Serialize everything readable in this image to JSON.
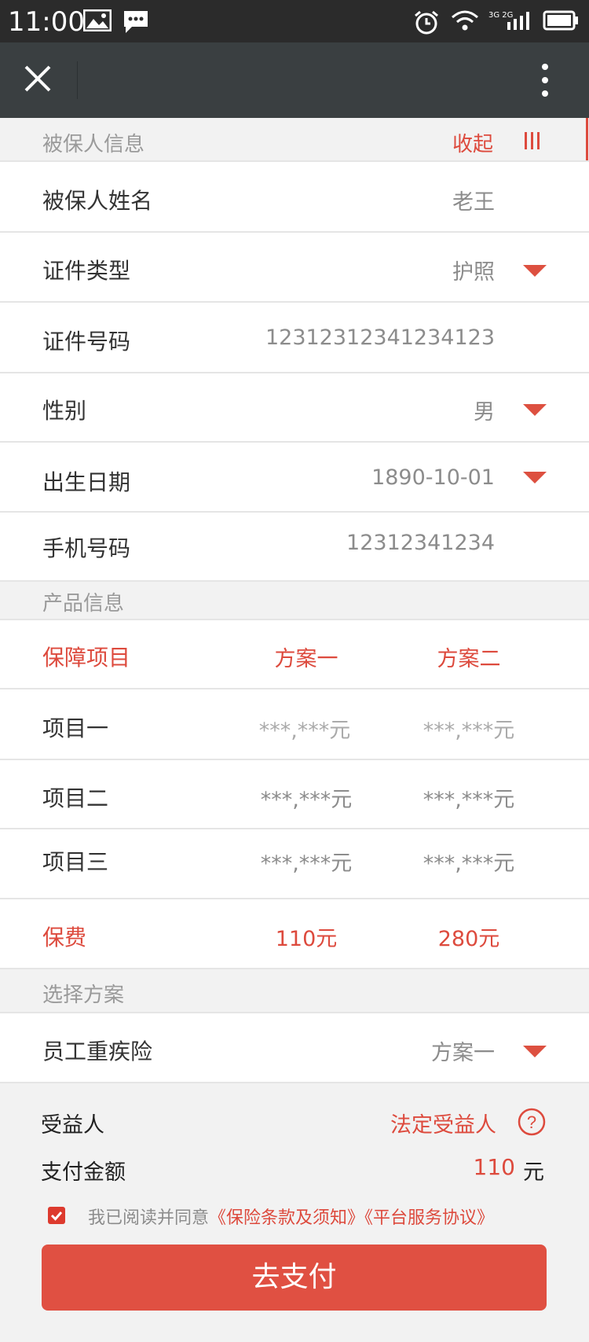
{
  "statusbar": {
    "time": "11:00",
    "network": "3G 2G"
  },
  "insured": {
    "section_title": "被保人信息",
    "collapse_label": "收起",
    "rows": [
      {
        "label": "被保人姓名",
        "value": "老王"
      },
      {
        "label": "证件类型",
        "value": "护照"
      },
      {
        "label": "证件号码",
        "value": "12312312341234123"
      },
      {
        "label": "性别",
        "value": "男"
      },
      {
        "label": "出生日期",
        "value": "1890-10-01"
      },
      {
        "label": "手机号码",
        "value": "12312341234"
      }
    ]
  },
  "product": {
    "section_title": "产品信息",
    "header": {
      "item": "保障项目",
      "plan1": "方案一",
      "plan2": "方案二"
    },
    "items": [
      {
        "name": "项目一",
        "plan1": "***,***元",
        "plan2": "***,***元"
      },
      {
        "name": "项目二",
        "plan1": "***,***元",
        "plan2": "***,***元"
      },
      {
        "name": "项目三",
        "plan1": "***,***元",
        "plan2": "***,***元"
      }
    ],
    "premium": {
      "label": "保费",
      "plan1": "110元",
      "plan2": "280元"
    }
  },
  "plan_select": {
    "section_title": "选择方案",
    "label": "员工重疾险",
    "value": "方案一"
  },
  "summary": {
    "beneficiary_label": "受益人",
    "beneficiary_value": "法定受益人",
    "amount_label": "支付金额",
    "amount_value": "110",
    "amount_unit": "元",
    "agree_prefix": "我已阅读并同意",
    "terms_link": "《保险条款及须知》",
    "service_link": "《平台服务协议》",
    "pay_button": "去支付"
  },
  "colors": {
    "accent": "#dd4a3d",
    "navbar": "#3a3f41",
    "statusbar": "#2b2b2b"
  }
}
